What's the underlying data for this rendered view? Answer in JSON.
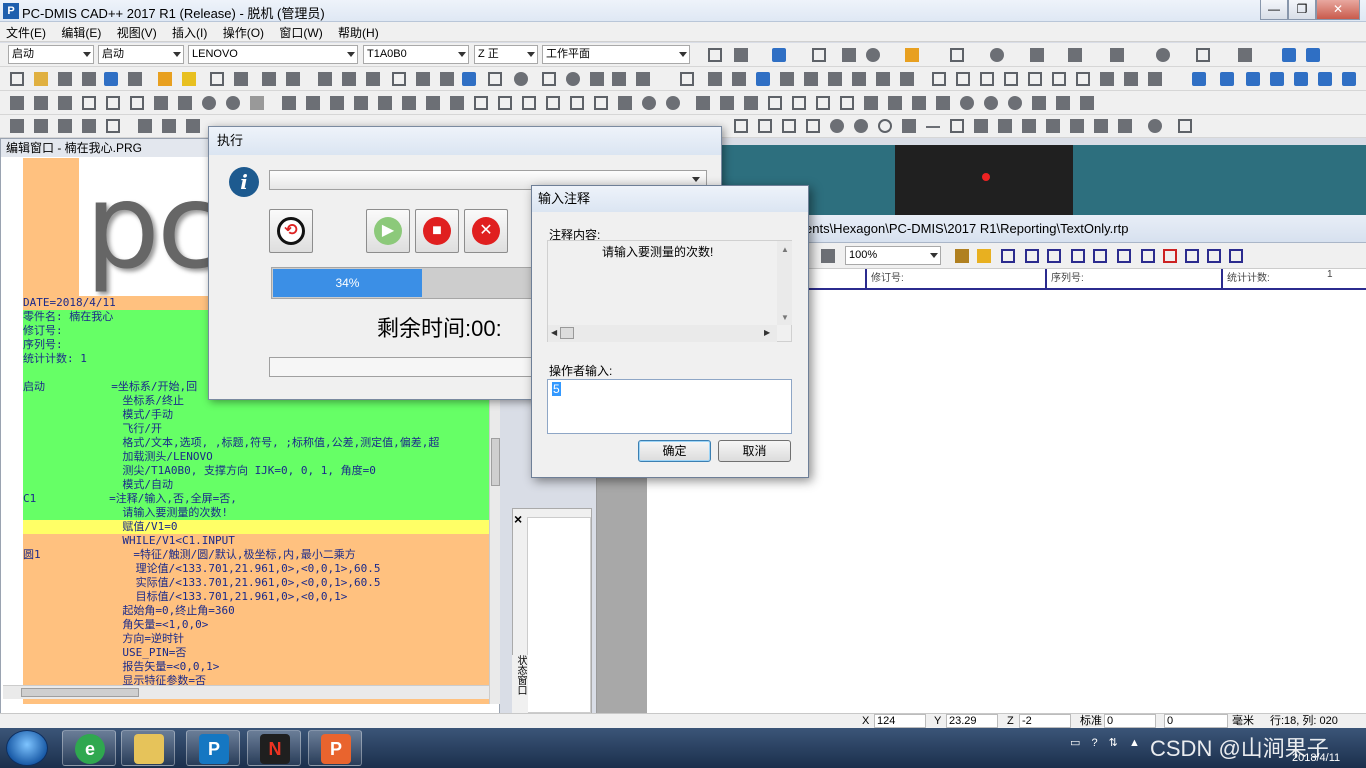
{
  "window": {
    "title": "PC-DMIS CAD++ 2017 R1 (Release) - 脱机 (管理员)",
    "app_icon": "P",
    "btn_min": "—",
    "btn_max": "❐",
    "btn_close": "✕"
  },
  "menu": [
    "文件(E)",
    "编辑(E)",
    "视图(V)",
    "插入(I)",
    "操作(O)",
    "窗口(W)",
    "帮助(H)"
  ],
  "toolbar_combos": {
    "alignment": "启动",
    "alignment2": "启动",
    "probe_file": "LENOVO",
    "tip": "T1A0B0",
    "view": "Z 正",
    "workplane": "工作平面"
  },
  "editor": {
    "title": "编辑窗口 - 楠在我心.PRG",
    "logo_text": "pc",
    "lines": [
      {
        "text": "DATE=2018/4/11",
        "bg": "orange"
      },
      {
        "text": "零件名: 楠在我心",
        "bg": "green"
      },
      {
        "text": "修订号:",
        "bg": "green"
      },
      {
        "text": "序列号:",
        "bg": "green"
      },
      {
        "text": "统计计数: 1",
        "bg": "green"
      },
      {
        "text": "",
        "bg": "green"
      },
      {
        "text": "启动          =坐标系/开始,回",
        "bg": "green"
      },
      {
        "text": "               坐标系/终止",
        "bg": "green"
      },
      {
        "text": "               模式/手动",
        "bg": "green"
      },
      {
        "text": "               飞行/开",
        "bg": "green"
      },
      {
        "text": "               格式/文本,选项, ,标题,符号, ;标称值,公差,测定值,偏差,超",
        "bg": "green"
      },
      {
        "text": "               加载测头/LENOVO",
        "bg": "green"
      },
      {
        "text": "               测尖/T1A0B0, 支撑方向 IJK=0, 0, 1, 角度=0",
        "bg": "green"
      },
      {
        "text": "               模式/自动",
        "bg": "green"
      },
      {
        "text": "C1           =注释/输入,否,全屏=否,",
        "bg": "green"
      },
      {
        "text": "               请输入要测量的次数!",
        "bg": "green"
      },
      {
        "text": "               赋值/V1=0",
        "bg": "yellow"
      },
      {
        "text": "               WHILE/V1<C1.INPUT",
        "bg": "orange"
      },
      {
        "text": "圆1              =特征/触测/圆/默认,极坐标,内,最小二乘方",
        "bg": "orange"
      },
      {
        "text": "                 理论值/<133.701,21.961,0>,<0,0,1>,60.5",
        "bg": "orange"
      },
      {
        "text": "                 实际值/<133.701,21.961,0>,<0,0,1>,60.5",
        "bg": "orange"
      },
      {
        "text": "                 目标值/<133.701,21.961,0>,<0,0,1>",
        "bg": "orange"
      },
      {
        "text": "               起始角=0,终止角=360",
        "bg": "orange"
      },
      {
        "text": "               角矢量=<1,0,0>",
        "bg": "orange"
      },
      {
        "text": "               方向=逆时针",
        "bg": "orange"
      },
      {
        "text": "               USE_PIN=否",
        "bg": "orange"
      },
      {
        "text": "               报告矢量=<0,0,1>",
        "bg": "orange"
      },
      {
        "text": "               显示特征参数=否",
        "bg": "orange"
      }
    ]
  },
  "report": {
    "title": "ents\\Hexagon\\PC-DMIS\\2017 R1\\Reporting\\TextOnly.rtp",
    "zoom": "100%",
    "headers": [
      "修订号:",
      "序列号:",
      "统计计数:"
    ],
    "header_count": "1"
  },
  "status_panel_label": "状态窗口",
  "execute_dialog": {
    "title": "执行",
    "progress_percent": 34,
    "progress_label": "34%",
    "remaining": "剩余时间:00:",
    "icons": {
      "info": "info-icon",
      "reset": "reset-icon",
      "play": "play-icon",
      "stop": "stop-icon",
      "cancel": "cancel-icon"
    }
  },
  "note_dialog": {
    "title": "输入注释",
    "content_label": "注释内容:",
    "content_text": "请输入要测量的次数!",
    "input_label": "操作者输入:",
    "input_value": "5",
    "ok": "确定",
    "cancel": "取消"
  },
  "statusbar": {
    "x_label": "X",
    "x": "124",
    "y_label": "Y",
    "y": "23.29",
    "z_label": "Z",
    "z": "-2",
    "std_label": "标准",
    "std": "0",
    "extra": "0",
    "unit": "毫米",
    "position": "行:18, 列: 020"
  },
  "taskbar": {
    "date": "2018/4/11",
    "watermark": "CSDN @山涧果子",
    "apps": [
      "ie-icon",
      "explorer-icon",
      "pcdmis-icon",
      "hexagon-icon",
      "powerpoint-icon"
    ]
  },
  "colors": {
    "progress": "#3b8fe6",
    "editor_green": "#66ff66",
    "editor_orange": "#ffc17f",
    "editor_yellow": "#ffff66"
  }
}
